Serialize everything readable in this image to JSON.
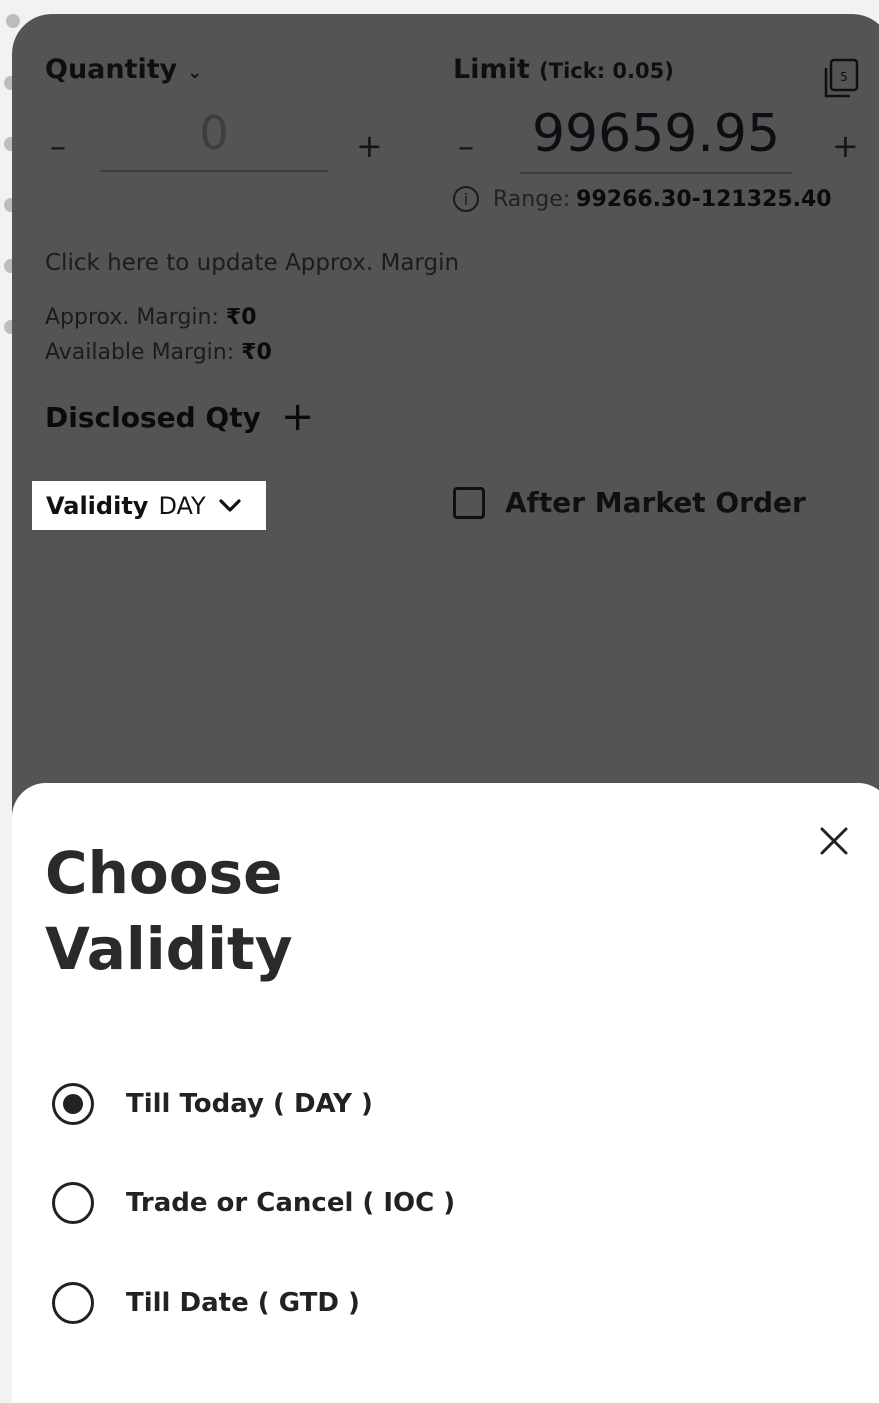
{
  "order": {
    "quantity_label": "Quantity",
    "quantity_value": "0",
    "limit_label": "Limit",
    "tick_text": "(Tick: 0.05)",
    "limit_value": "99659.95",
    "minus": "–",
    "plus": "+",
    "range_label": "Range:",
    "range_value": "99266.30-121325.40",
    "update_margin_link": "Click here to update Approx. Margin",
    "approx_margin_label": "Approx. Margin:",
    "approx_margin_value": "₹0",
    "available_margin_label": "Available Margin:",
    "available_margin_value": "₹0",
    "disclosed_qty_label": "Disclosed Qty",
    "after_market_label": "After Market Order",
    "copy_badge": "5"
  },
  "validity": {
    "label": "Validity",
    "value": "DAY"
  },
  "sheet": {
    "title": "Choose Validity",
    "options": [
      {
        "label": "Till Today ( DAY )",
        "selected": true
      },
      {
        "label": "Trade or Cancel ( IOC )",
        "selected": false
      },
      {
        "label": "Till Date ( GTD )",
        "selected": false
      }
    ]
  }
}
